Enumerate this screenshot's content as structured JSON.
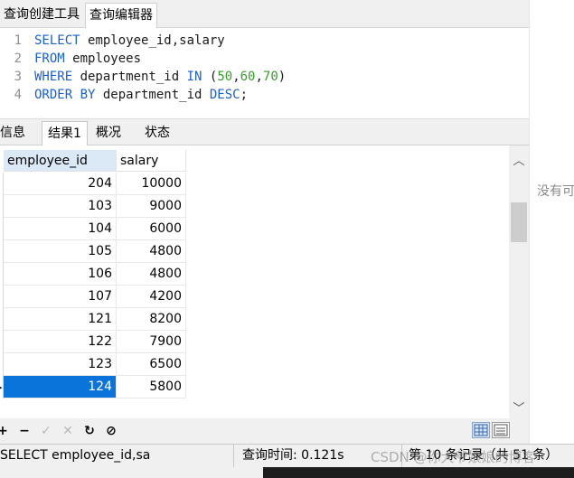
{
  "top_tabs": [
    "查询创建工具",
    "查询编辑器"
  ],
  "editor": {
    "lines": [
      {
        "n": "1",
        "tokens": [
          {
            "t": "SELECT ",
            "c": "kw"
          },
          {
            "t": "employee_id,salary",
            "c": "plain"
          }
        ]
      },
      {
        "n": "2",
        "tokens": [
          {
            "t": "FROM ",
            "c": "kw"
          },
          {
            "t": "employees",
            "c": "plain"
          }
        ]
      },
      {
        "n": "3",
        "tokens": [
          {
            "t": "WHERE ",
            "c": "kw"
          },
          {
            "t": "department_id ",
            "c": "plain"
          },
          {
            "t": "IN ",
            "c": "kw"
          },
          {
            "t": "(",
            "c": "plain"
          },
          {
            "t": "50",
            "c": "num"
          },
          {
            "t": ",",
            "c": "plain"
          },
          {
            "t": "60",
            "c": "num"
          },
          {
            "t": ",",
            "c": "plain"
          },
          {
            "t": "70",
            "c": "num"
          },
          {
            "t": ")",
            "c": "plain"
          }
        ]
      },
      {
        "n": "4",
        "tokens": [
          {
            "t": "ORDER BY ",
            "c": "kw"
          },
          {
            "t": "department_id ",
            "c": "plain"
          },
          {
            "t": "DESC",
            "c": "kw"
          },
          {
            "t": ";",
            "c": "plain"
          }
        ]
      }
    ]
  },
  "result_tabs": [
    "信息",
    "结果1",
    "概况",
    "状态"
  ],
  "grid": {
    "columns": [
      "employee_id",
      "salary"
    ],
    "rows": [
      [
        "204",
        "10000"
      ],
      [
        "103",
        "9000"
      ],
      [
        "104",
        "6000"
      ],
      [
        "105",
        "4800"
      ],
      [
        "106",
        "4800"
      ],
      [
        "107",
        "4200"
      ],
      [
        "121",
        "8200"
      ],
      [
        "122",
        "7900"
      ],
      [
        "123",
        "6500"
      ],
      [
        "124",
        "5800"
      ]
    ],
    "selected_row": 9,
    "selected_marker": "▸"
  },
  "scroll": {
    "up": "︿",
    "down": "﹀"
  },
  "toolbar": {
    "buttons": [
      {
        "name": "add-record-button",
        "glyph": "+",
        "enabled": true
      },
      {
        "name": "delete-record-button",
        "glyph": "−",
        "enabled": true
      },
      {
        "name": "apply-changes-button",
        "glyph": "✓",
        "enabled": false
      },
      {
        "name": "discard-changes-button",
        "glyph": "✕",
        "enabled": false
      },
      {
        "name": "refresh-button",
        "glyph": "↻",
        "enabled": true
      },
      {
        "name": "stop-button",
        "glyph": "⊘",
        "enabled": true
      }
    ]
  },
  "status": {
    "query": "SELECT employee_id,sa",
    "time": "查询时间: 0.121s",
    "records": "第 10 条记录（共 51 条）"
  },
  "right_panel": {
    "text": "没有可"
  },
  "watermark": "CSDN @你大爷娘娘的博客",
  "colors": {
    "keyword": "#1b5fd0",
    "number": "#3a9c2e",
    "selection": "#0a74da",
    "header_active": "#dbe8f6"
  }
}
